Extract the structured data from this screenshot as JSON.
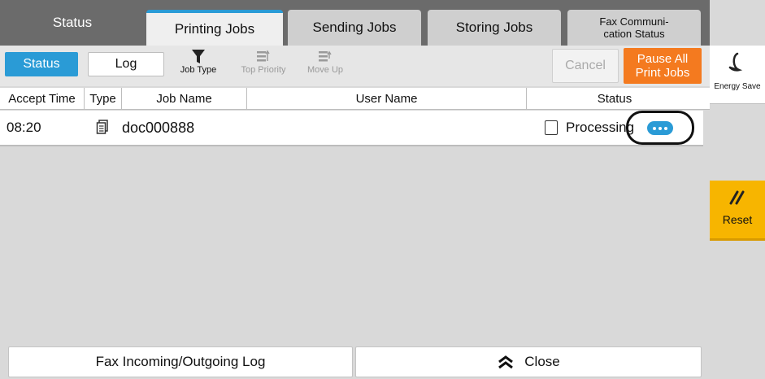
{
  "tabs": [
    {
      "label": "Status",
      "state": "header"
    },
    {
      "label": "Printing Jobs",
      "state": "active"
    },
    {
      "label": "Sending Jobs",
      "state": "normal"
    },
    {
      "label": "Storing Jobs",
      "state": "normal"
    },
    {
      "label": "Fax Communi-\ncation Status",
      "state": "normal"
    }
  ],
  "side": {
    "energy_save_label": "Energy Save",
    "energy_icon": "crescent-moon-icon",
    "reset_label": "Reset",
    "reset_icon": "reset-slash-icon"
  },
  "toolbar": {
    "status_label": "Status",
    "log_label": "Log",
    "job_type_label": "Job Type",
    "top_priority_label": "Top Priority",
    "move_up_label": "Move Up",
    "cancel_label": "Cancel",
    "pause_label": "Pause All\nPrint Jobs"
  },
  "table": {
    "headers": [
      "Accept Time",
      "Type",
      "Job Name",
      "User Name",
      "Status"
    ],
    "rows": [
      {
        "accept_time": "08:20",
        "type_icon": "document-stack-icon",
        "job_name": "doc000888",
        "user_name": "",
        "status": "Processing"
      }
    ]
  },
  "bottom": {
    "fax_log_label": "Fax Incoming/Outgoing Log",
    "close_label": "Close"
  },
  "colors": {
    "accent_blue": "#2a9bd6",
    "pause_orange": "#f47a1f",
    "reset_yellow": "#f7b500",
    "tab_bar_gray": "#6b6b6b"
  }
}
